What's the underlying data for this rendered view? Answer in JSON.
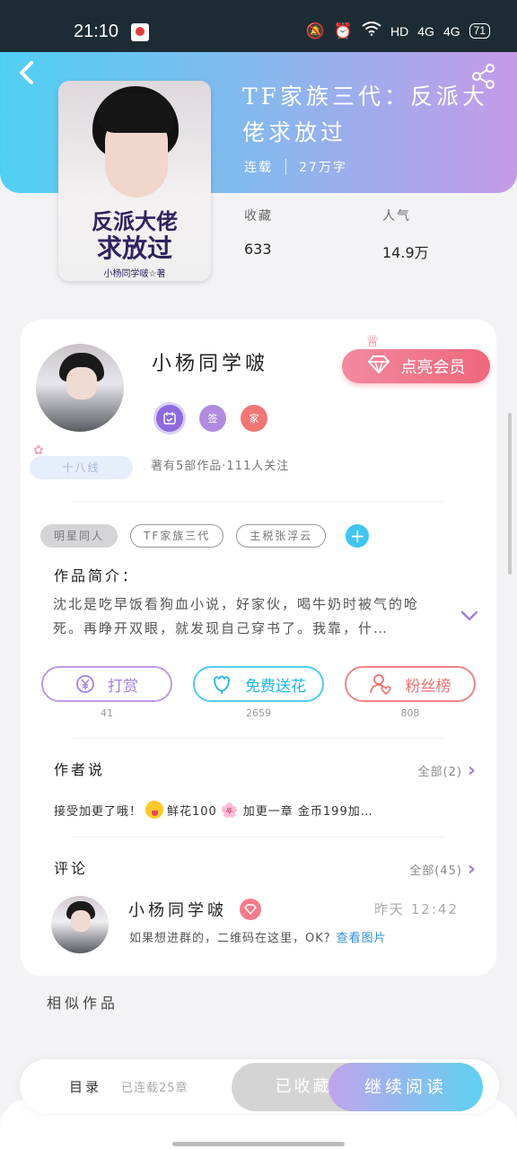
{
  "status_bar": {
    "time": "21:10",
    "network": "HD",
    "signal1": "4G",
    "signal2": "4G",
    "battery": "71",
    "icons": [
      "mute-bell-icon",
      "alarm-icon",
      "wifi-icon"
    ]
  },
  "book": {
    "title": "TF家族三代：反派大佬求放过",
    "status": "连载",
    "word_count": "27万字",
    "cover_title_line1": "反派大佬",
    "cover_title_line2": "求放过",
    "cover_author": "小杨同学啵☆著",
    "stats": [
      {
        "label": "收藏",
        "value": "633"
      },
      {
        "label": "人气",
        "value": "14.9万"
      }
    ]
  },
  "author": {
    "name": "小杨同学啵",
    "vip_button": "点亮会员",
    "badges": [
      "",
      "签",
      "家"
    ],
    "fan_tag": "十八线",
    "info": "著有5部作品·111人关注"
  },
  "tags": [
    "明星同人",
    "TF家族三代",
    "主税张浮云"
  ],
  "intro": {
    "title": "作品简介：",
    "text": "沈北是吃早饭看狗血小说，好家伙，喝牛奶时被气的呛死。再睁开双眼，就发现自己穿书了。我靠，什…"
  },
  "actions": [
    {
      "label": "打赏",
      "count": "41",
      "icon": "yen-coin-icon"
    },
    {
      "label": "免费送花",
      "count": "2659",
      "icon": "flower-icon"
    },
    {
      "label": "粉丝榜",
      "count": "808",
      "icon": "fans-heart-icon"
    }
  ],
  "author_say": {
    "title": "作者说",
    "see_all": "全部(2)",
    "text_part1": "接受加更了哦！",
    "text_part2": "鲜花100",
    "text_part3": "加更一章 金币199加…"
  },
  "comments": {
    "title": "评论",
    "see_all": "全部(45)",
    "items": [
      {
        "name": "小杨同学啵",
        "time": "昨天 12:42",
        "text": "如果想进群的，二维码在这里，OK?",
        "link": "查看图片"
      }
    ]
  },
  "similar": {
    "title": "相似作品"
  },
  "bottom_bar": {
    "catalog": "目录",
    "catalog_sub": "已连载25章",
    "collected": "已收藏",
    "continue_read": "继续阅读"
  }
}
